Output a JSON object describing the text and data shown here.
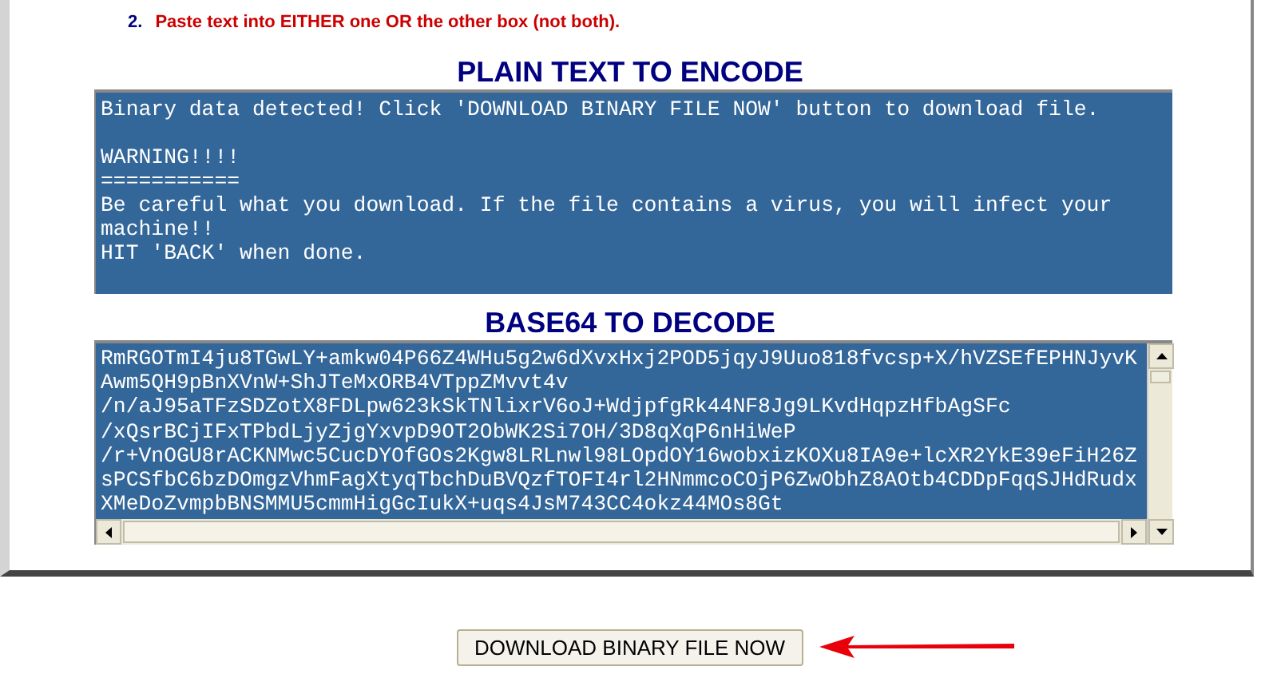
{
  "instruction": {
    "number": "2.",
    "text": "Paste text into EITHER one OR the other box (not both)."
  },
  "plain_text": {
    "heading": "PLAIN TEXT TO ENCODE",
    "paragraphs": [
      [
        "Binary data detected! Click 'DOWNLOAD BINARY FILE NOW' button to download file."
      ],
      [
        "WARNING!!!!",
        "===========",
        "Be careful what you download. If the file contains a virus, you will infect your",
        "machine!!",
        "HIT 'BACK' when done."
      ]
    ]
  },
  "base64": {
    "heading": "BASE64 TO DECODE",
    "lines": [
      "RmRGOTmI4ju8TGwLY+amkw04P66Z4WHu5g2w6dXvxHxj2POD5jqyJ9Uuo818fvcsp+X/hVZSEfEPHNJyvK",
      "Awm5QH9pBnXVnW+ShJTeMxORB4VTppZMvvt4v",
      "/n/aJ95aTFzSDZotX8FDLpw623kSkTNlixrV6oJ+WdjpfgRk44NF8Jg9LKvdHqpzHfbAgSFc",
      "/xQsrBCjIFxTPbdLjyZjgYxvpD9OT2ObWK2Si7OH/3D8qXqP6nHiWeP",
      "/r+VnOGU8rACKNMwc5CucDYOfGOs2Kgw8LRLnwl98LOpdOY16wobxizKOXu8IA9e+lcXR2YkE39eFiH26Z",
      "sPCSfbC6bzDOmgzVhmFagXtyqTbchDuBVQzfTOFI4rl2HNmmcoCOjP6ZwObhZ8AOtb4CDDpFqqSJHdRudx",
      "XMeDoZvmpbBNSMMU5cmmHigGcIukX+uqs4JsM743CC4okz44MOs8Gt"
    ]
  },
  "download_button": {
    "label": "DOWNLOAD BINARY FILE NOW"
  }
}
